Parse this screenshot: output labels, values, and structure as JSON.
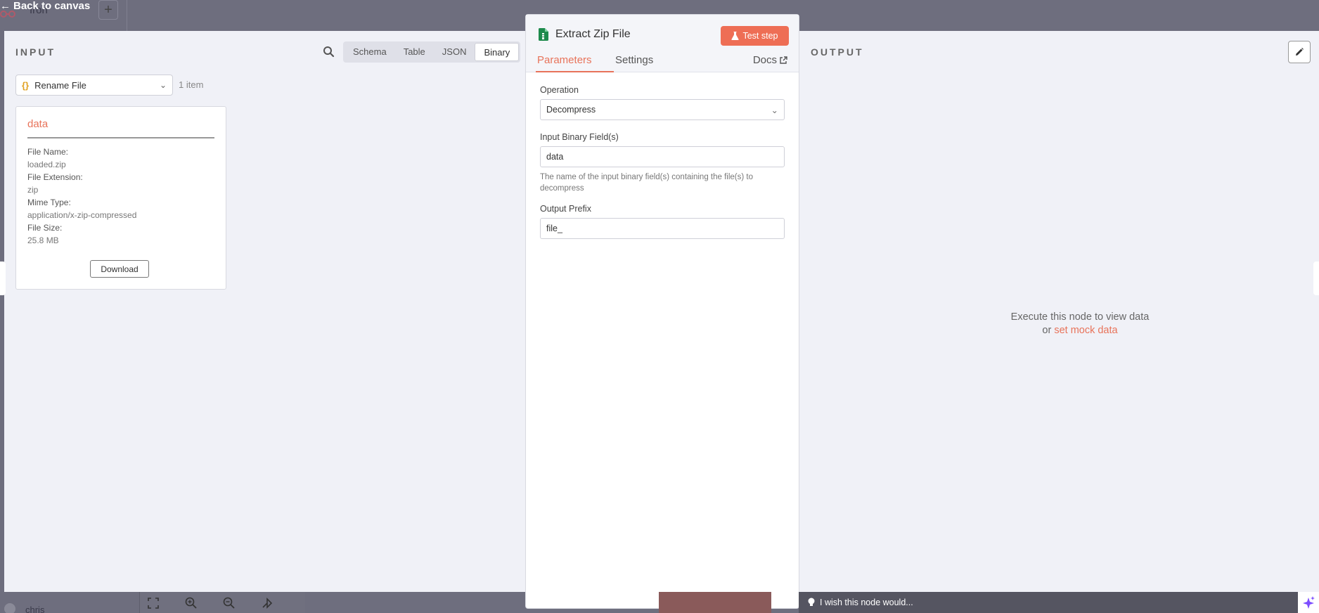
{
  "canvas": {
    "back_label": "Back to canvas",
    "workflow_name": "Iron",
    "user_name": "chris"
  },
  "input": {
    "title": "INPUT",
    "view_tabs": [
      "Schema",
      "Table",
      "JSON",
      "Binary"
    ],
    "active_tab": "Binary",
    "node_select": "Rename File",
    "item_count": "1 item",
    "binary": {
      "title": "data",
      "file_name_label": "File Name:",
      "file_name": "loaded.zip",
      "file_ext_label": "File Extension:",
      "file_ext": "zip",
      "mime_label": "Mime Type:",
      "mime": "application/x-zip-compressed",
      "size_label": "File Size:",
      "size": "25.8 MB",
      "download_label": "Download"
    }
  },
  "node": {
    "title": "Extract Zip File",
    "test_label": "Test step",
    "tabs": {
      "parameters": "Parameters",
      "settings": "Settings",
      "docs": "Docs"
    },
    "fields": {
      "operation_label": "Operation",
      "operation_value": "Decompress",
      "binary_field_label": "Input Binary Field(s)",
      "binary_field_value": "data",
      "binary_field_hint": "The name of the input binary field(s) containing the file(s) to decompress",
      "prefix_label": "Output Prefix",
      "prefix_value": "file_"
    }
  },
  "output": {
    "title": "OUTPUT",
    "empty_line1": "Execute this node to view data",
    "empty_or": "or",
    "empty_link": "set mock data"
  },
  "feedback": {
    "placeholder": "I wish this node would..."
  },
  "colors": {
    "accent": "#e8735a",
    "test_button": "#ee6e55",
    "panel_bg": "#f0f1f7",
    "overlay": "#6e6e7e"
  }
}
